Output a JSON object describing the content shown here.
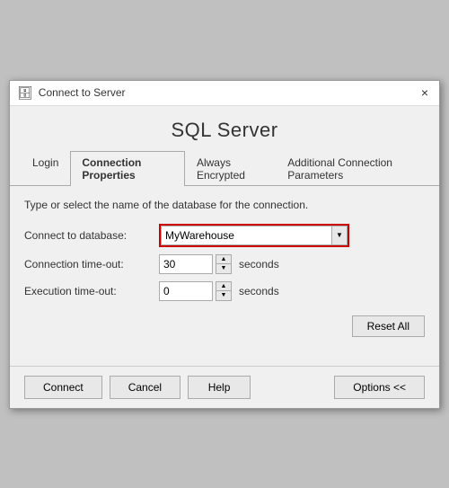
{
  "window": {
    "title": "Connect to Server",
    "icon": "🗄",
    "close_label": "×"
  },
  "app_title": "SQL Server",
  "tabs": [
    {
      "id": "login",
      "label": "Login",
      "active": false
    },
    {
      "id": "connection-properties",
      "label": "Connection Properties",
      "active": true
    },
    {
      "id": "always-encrypted",
      "label": "Always Encrypted",
      "active": false
    },
    {
      "id": "additional-connection",
      "label": "Additional Connection Parameters",
      "active": false
    }
  ],
  "form": {
    "description": "Type or select the name of the database for the connection.",
    "connect_to_db_label": "Connect to database:",
    "connect_to_db_value": "MyWarehouse",
    "connect_to_db_placeholder": "MyWarehouse",
    "connection_timeout_label": "Connection time-out:",
    "connection_timeout_value": "30",
    "connection_timeout_unit": "seconds",
    "execution_timeout_label": "Execution time-out:",
    "execution_timeout_value": "0",
    "execution_timeout_unit": "seconds",
    "reset_all_label": "Reset All"
  },
  "footer": {
    "connect_label": "Connect",
    "cancel_label": "Cancel",
    "help_label": "Help",
    "options_label": "Options <<"
  }
}
